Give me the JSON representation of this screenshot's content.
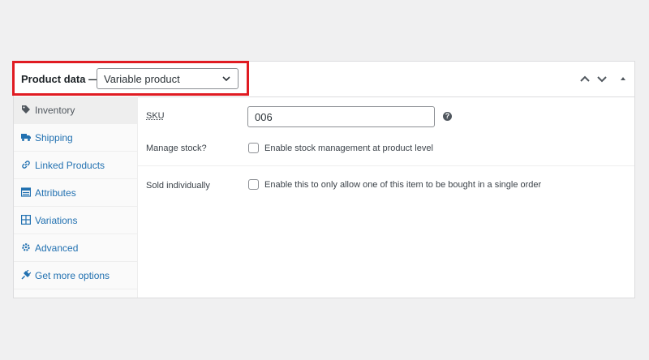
{
  "header": {
    "title": "Product data —",
    "product_type": "Variable product"
  },
  "sidebar": {
    "items": [
      {
        "label": "Inventory",
        "icon": "tag-icon"
      },
      {
        "label": "Shipping",
        "icon": "truck-icon"
      },
      {
        "label": "Linked Products",
        "icon": "link-icon"
      },
      {
        "label": "Attributes",
        "icon": "list-table-icon"
      },
      {
        "label": "Variations",
        "icon": "grid-icon"
      },
      {
        "label": "Advanced",
        "icon": "gear-icon"
      },
      {
        "label": "Get more options",
        "icon": "plugin-icon"
      }
    ]
  },
  "inventory": {
    "sku_label": "SKU",
    "sku_value": "006",
    "help_glyph": "?",
    "manage_stock_label": "Manage stock?",
    "manage_stock_option": "Enable stock management at product level",
    "sold_individually_label": "Sold individually",
    "sold_individually_option": "Enable this to only allow one of this item to be bought in a single order"
  },
  "colors": {
    "highlight": "#e01b22",
    "link": "#2271b1"
  }
}
